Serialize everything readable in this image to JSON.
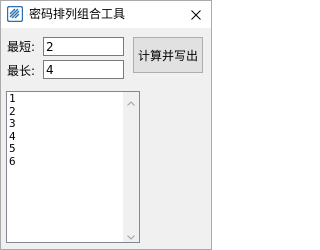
{
  "window": {
    "title": "密码排列组合工具",
    "app_icon": "striped-square-icon",
    "close_icon": "close-icon"
  },
  "form": {
    "min_label": "最短:",
    "min_value": "2",
    "max_label": "最长:",
    "max_value": "4",
    "compute_button": "计算并写出"
  },
  "output": {
    "lines": [
      "1",
      "2",
      "3",
      "4",
      "5",
      "6"
    ]
  },
  "colors": {
    "accent": "#2b6fb6",
    "window_bg": "#f0f0f0"
  }
}
